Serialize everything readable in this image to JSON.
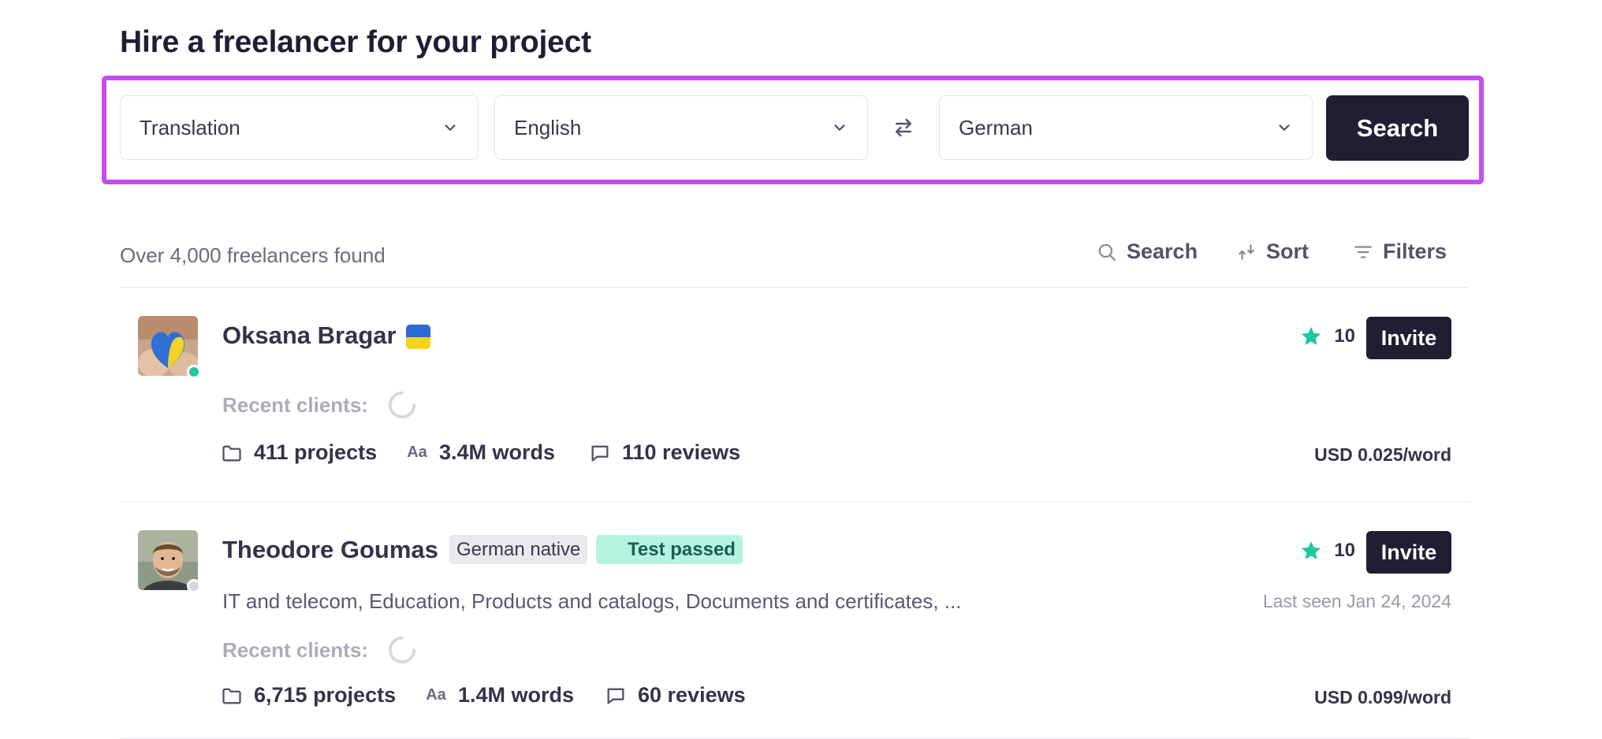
{
  "page_title": "Hire a freelancer for your project",
  "search_bar": {
    "service": "Translation",
    "source_language": "English",
    "target_language": "German",
    "search_label": "Search",
    "accent_color": "#c64cf0"
  },
  "results": {
    "count_text": "Over 4,000 freelancers found",
    "toolbar": {
      "search_label": "Search",
      "sort_label": "Sort",
      "filters_label": "Filters"
    }
  },
  "freelancers": [
    {
      "name": "Oksana Bragar",
      "flag": "ukraine-flag-icon",
      "online": true,
      "rating": "10",
      "invite_label": "Invite",
      "recent_clients_label": "Recent clients:",
      "projects": "411 projects",
      "words": "3.4M words",
      "reviews": "110 reviews",
      "price": "USD 0.025/word"
    },
    {
      "name": "Theodore Goumas",
      "badges": [
        "German native",
        "Test passed"
      ],
      "online": false,
      "rating": "10",
      "invite_label": "Invite",
      "tags": "IT and telecom, Education, Products and catalogs, Documents and certificates, ...",
      "last_seen": "Last seen Jan 24, 2024",
      "recent_clients_label": "Recent clients:",
      "projects": "6,715 projects",
      "words": "1.4M words",
      "reviews": "60 reviews",
      "price": "USD 0.099/word"
    }
  ],
  "icons": {
    "words_glyph": "Aa"
  },
  "colors": {
    "primary_dark": "#211d33",
    "rating_star": "#1ec99b",
    "online_dot": "#1ec99b",
    "offline_dot": "#d6d6dc"
  }
}
